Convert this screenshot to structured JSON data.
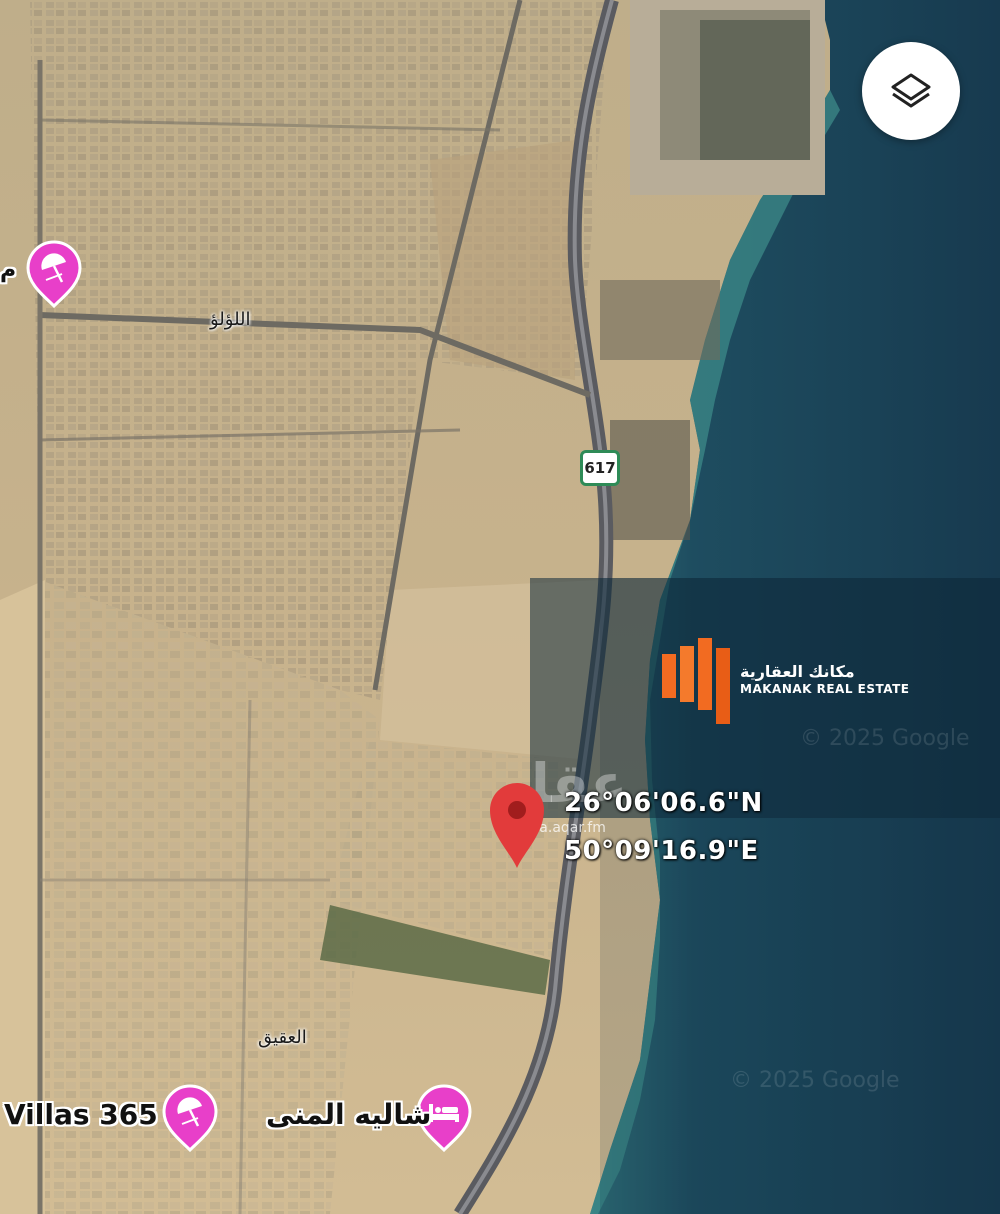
{
  "map": {
    "layers_button_icon": "layers-icon",
    "highway_shield": "617",
    "labels": {
      "street_alolou": "اللؤلؤ",
      "district_aqiq": "العقيق",
      "poi_left_partial": "م"
    },
    "pois": [
      {
        "name": "Villas 365",
        "icon": "beach-umbrella-icon"
      },
      {
        "name": "شاليه المنى",
        "icon": "bed-icon"
      },
      {
        "name": "م",
        "icon": "beach-umbrella-icon"
      }
    ],
    "pin": {
      "icon": "location-pin-icon",
      "lat": "26°06'06.6\"N",
      "lon": "50°09'16.9\"E"
    },
    "copyright": [
      "© 2025 Google",
      "© 2025 Google"
    ],
    "colors": {
      "sea": "#1c3f55",
      "land": "#c9b48f",
      "poi_pink": "#e83fc9",
      "pin_red": "#e23b3b",
      "brand_orange": "#f26b21"
    }
  },
  "branding": {
    "name_ar": "مكانك العقارية",
    "name_en": "MAKANAK REAL ESTATE",
    "watermark_site": "sa.aqar.fm",
    "watermark_logo_text": "عقار"
  }
}
